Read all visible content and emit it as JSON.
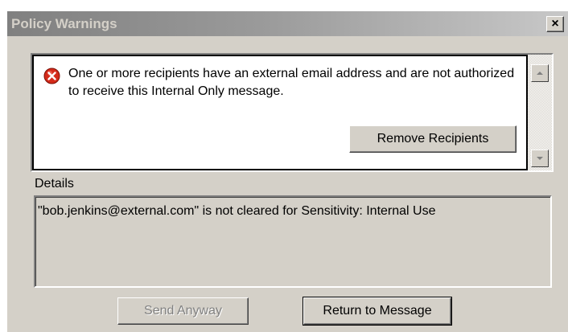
{
  "window": {
    "title": "Policy Warnings",
    "close_label": "×"
  },
  "warning": {
    "icon": "error-icon",
    "message": "One or more recipients have an external email address and are not authorized to receive this Internal Only message.",
    "remove_button_label": "Remove Recipients"
  },
  "details": {
    "label": "Details",
    "text": "\"bob.jenkins@external.com\" is not cleared for Sensitivity: Internal Use"
  },
  "buttons": {
    "send_anyway_label": "Send Anyway",
    "return_label": "Return to Message"
  },
  "colors": {
    "dialog_bg": "#d4d0c8",
    "title_gradient_start": "#808080",
    "title_gradient_end": "#c8c8c8",
    "error_red": "#d42a1a"
  }
}
